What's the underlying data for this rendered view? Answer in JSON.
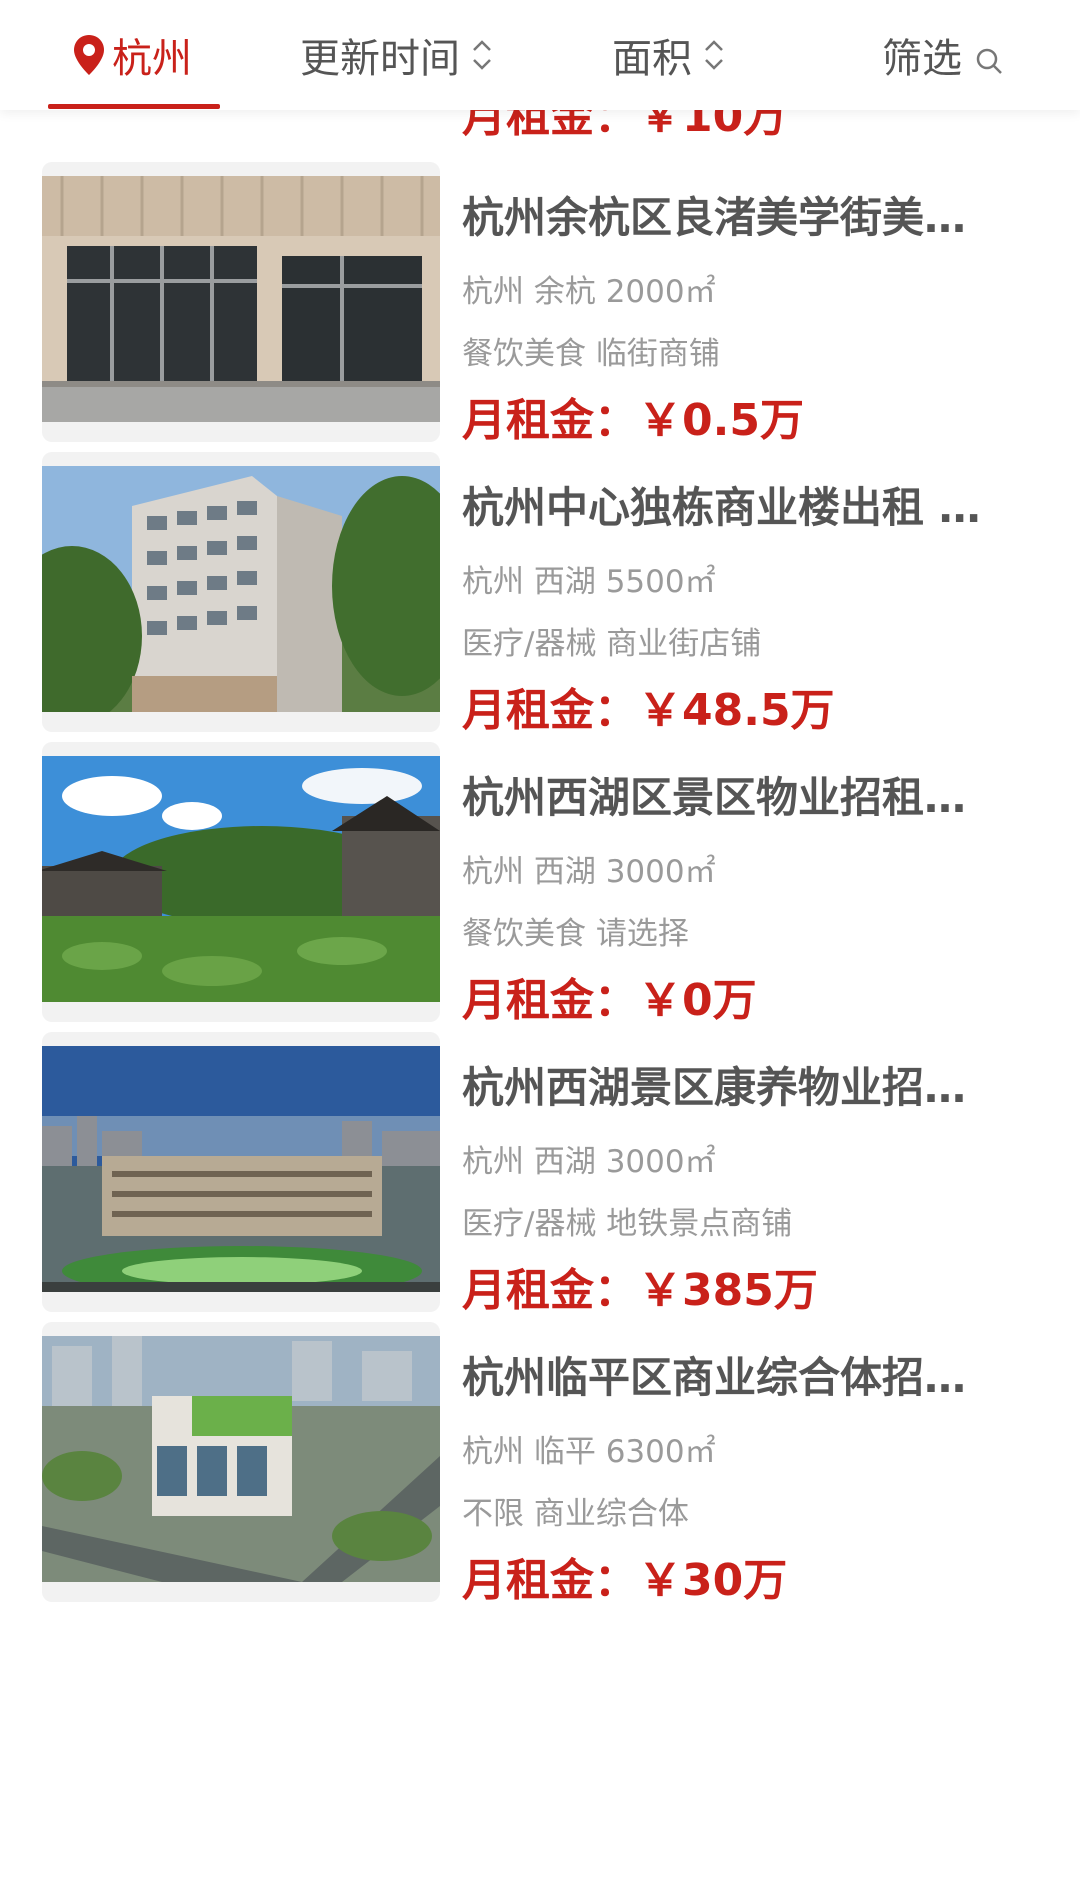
{
  "filters": {
    "city": "杭州",
    "update_time": "更新时间",
    "area": "面积",
    "filter": "筛选"
  },
  "peek_price": "月租金：￥10万",
  "listings": [
    {
      "title": "杭州余杭区良渚美学街美…",
      "location": "杭州 余杭 2000㎡",
      "tags": "餐饮美食 临街商铺",
      "price": "月租金：￥0.5万"
    },
    {
      "title": "杭州中心独栋商业楼出租 …",
      "location": "杭州 西湖 5500㎡",
      "tags": "医疗/器械 商业街店铺",
      "price": "月租金：￥48.5万"
    },
    {
      "title": "杭州西湖区景区物业招租…",
      "location": "杭州 西湖 3000㎡",
      "tags": "餐饮美食 请选择",
      "price": "月租金：￥0万"
    },
    {
      "title": "杭州西湖景区康养物业招…",
      "location": "杭州 西湖 3000㎡",
      "tags": "医疗/器械 地铁景点商铺",
      "price": "月租金：￥385万"
    },
    {
      "title": "杭州临平区商业综合体招…",
      "location": "杭州 临平 6300㎡",
      "tags": "不限 商业综合体",
      "price": "月租金：￥30万"
    }
  ],
  "icons": {
    "city_pin": "map-pin-icon",
    "sort": "sort-icon",
    "search": "search-icon"
  },
  "colors": {
    "accent": "#c9211a",
    "title_text": "#555555",
    "meta_text": "#9a9a9a"
  }
}
